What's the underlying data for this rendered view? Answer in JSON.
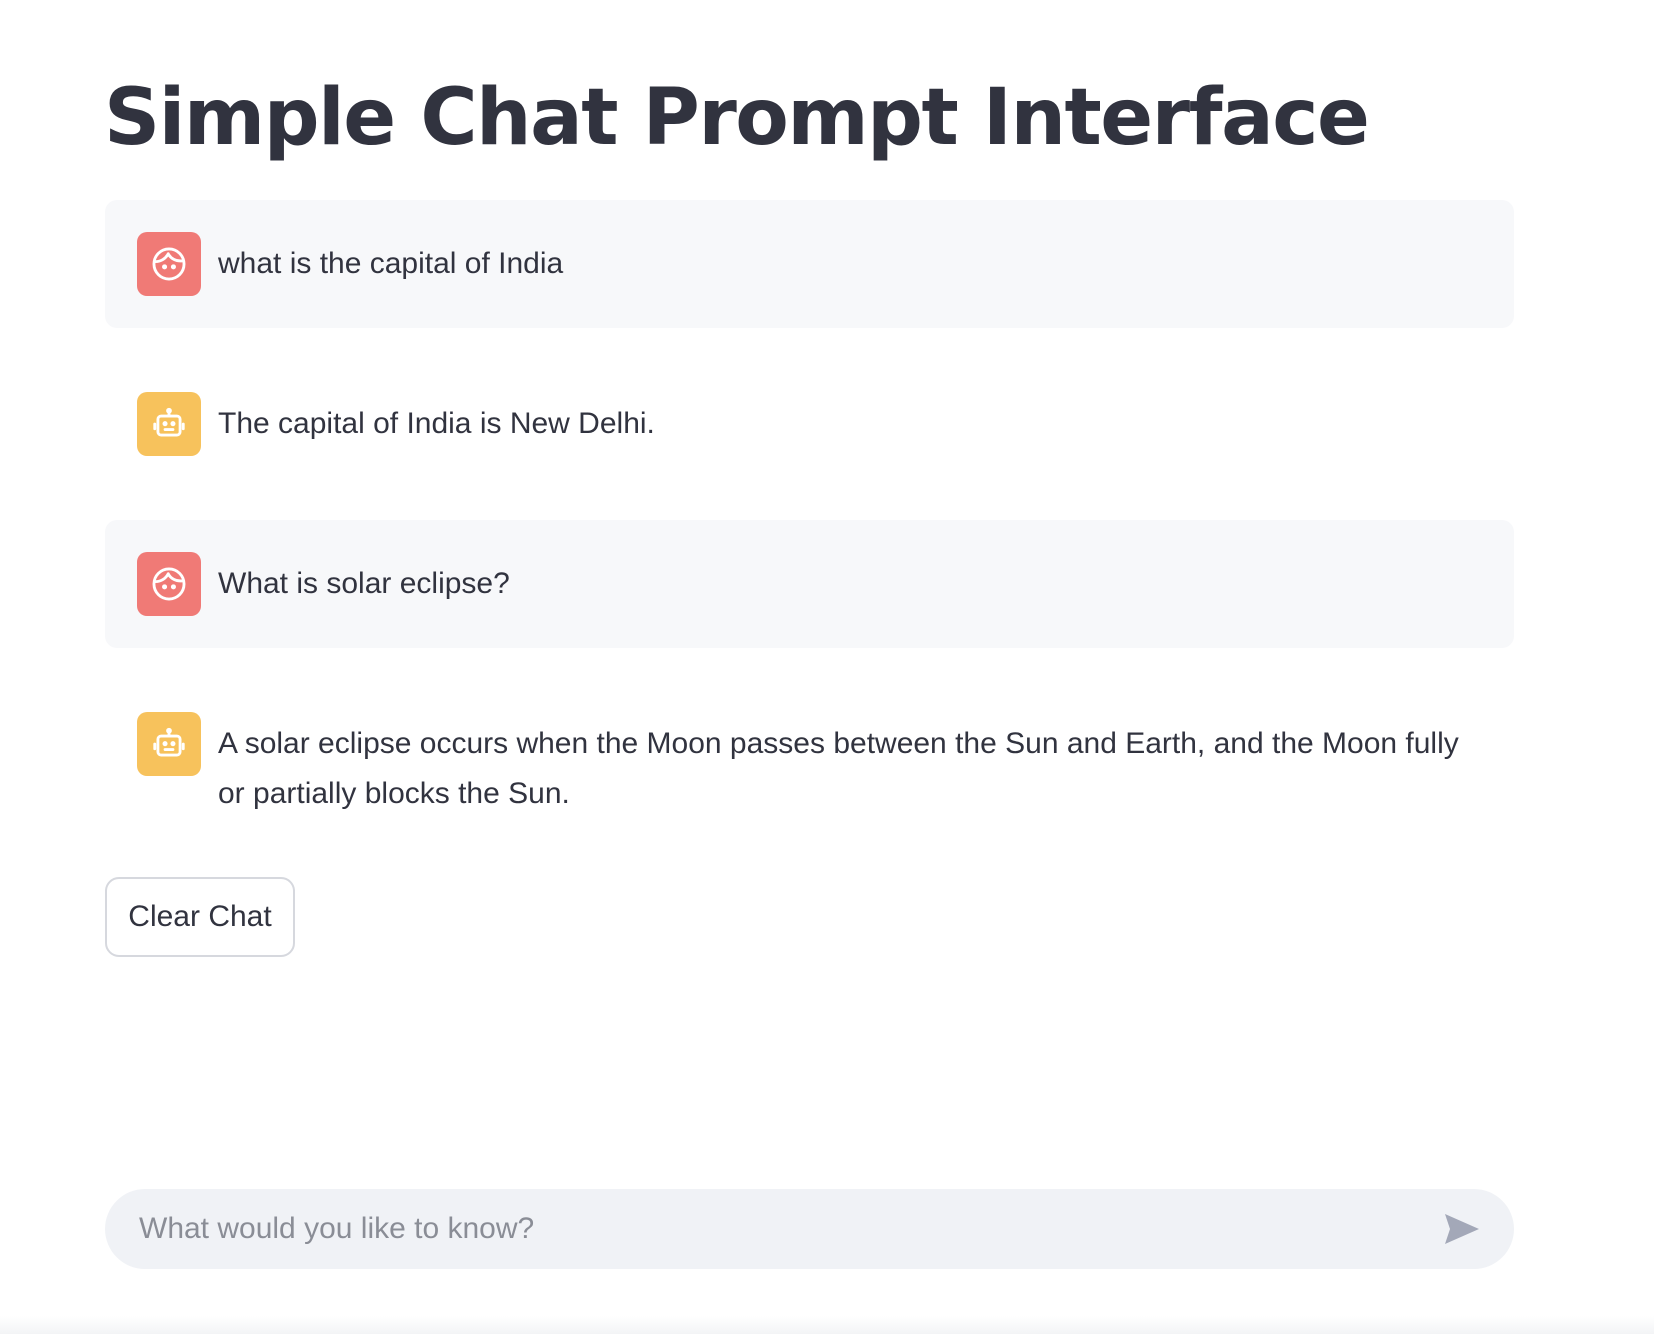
{
  "page": {
    "title": "Simple Chat Prompt Interface"
  },
  "messages": [
    {
      "role": "user",
      "avatar_icon": "user-face-icon",
      "text": "what is the capital of India"
    },
    {
      "role": "assistant",
      "avatar_icon": "robot-icon",
      "text": "The capital of India is New Delhi."
    },
    {
      "role": "user",
      "avatar_icon": "user-face-icon",
      "text": "What is solar eclipse?"
    },
    {
      "role": "assistant",
      "avatar_icon": "robot-icon",
      "text": "A solar eclipse occurs when the Moon passes between the Sun and Earth, and the Moon fully or partially blocks the Sun."
    }
  ],
  "controls": {
    "clear_label": "Clear Chat"
  },
  "chat_input": {
    "placeholder": "What would you like to know?",
    "value": "",
    "send_icon": "send-icon"
  },
  "colors": {
    "user_avatar": "#f07a76",
    "assistant_avatar": "#f7c25c",
    "user_bubble": "#f7f8fa",
    "input_bg": "#f0f2f6",
    "text": "#31333f"
  }
}
